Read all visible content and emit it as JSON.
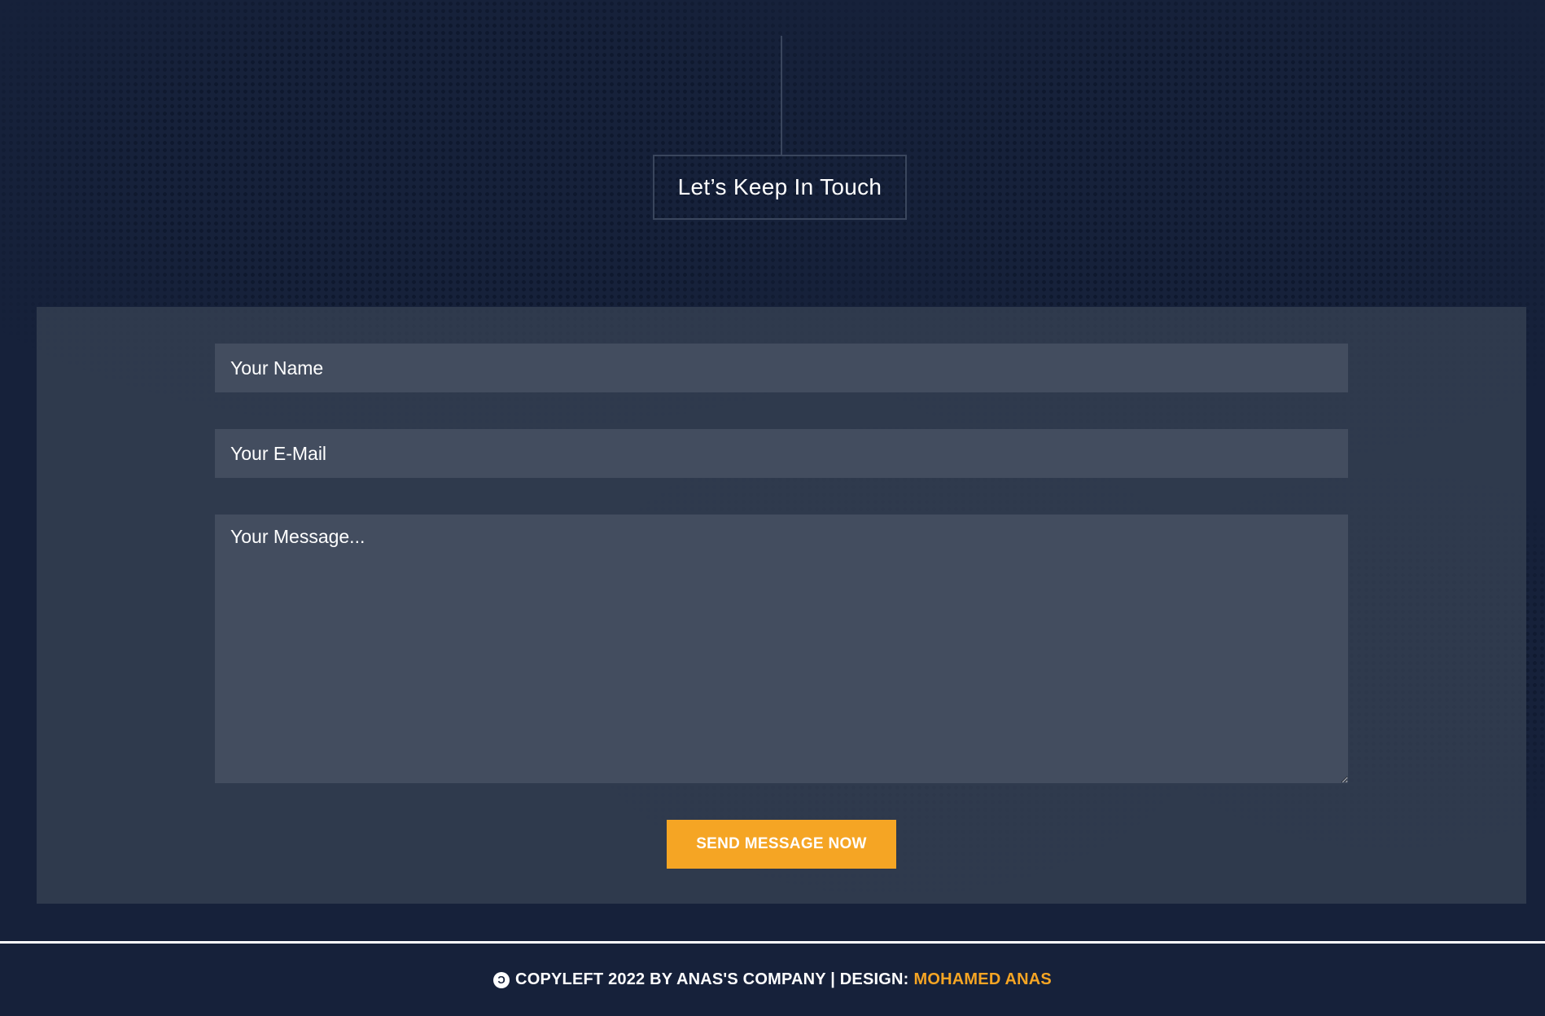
{
  "section": {
    "heading": "Let’s Keep In Touch"
  },
  "form": {
    "name_placeholder": "Your Name",
    "email_placeholder": "Your E-Mail",
    "message_placeholder": "Your Message...",
    "submit_label": "SEND MESSAGE NOW"
  },
  "footer": {
    "icon": "copyleft-icon",
    "icon_glyph": "C",
    "copyright_text": "COPYLEFT 2022 BY ANAS'S COMPANY | DESIGN:",
    "designer_name": "MOHAMED ANAS"
  },
  "colors": {
    "background": "#16213a",
    "panel": "#343f52",
    "field": "#434d5f",
    "accent": "#f5a524",
    "text": "#ffffff"
  }
}
